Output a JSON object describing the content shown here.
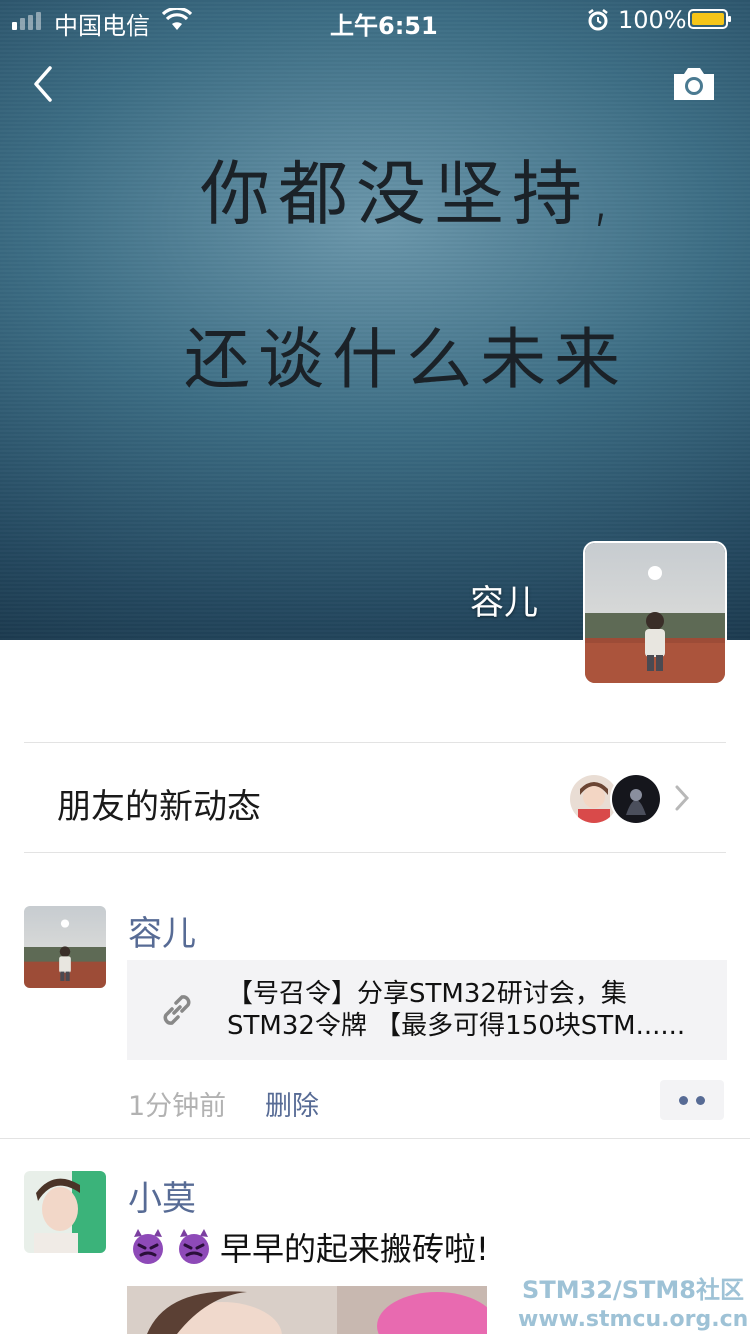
{
  "status_bar": {
    "carrier": "中国电信",
    "time": "上午6:51",
    "battery": "100%"
  },
  "cover": {
    "line1": "你都没坚持,",
    "line2": "还谈什么未来",
    "owner_name": "容儿"
  },
  "friends_updates": {
    "label": "朋友的新动态"
  },
  "posts": [
    {
      "name": "容儿",
      "link_line1": "【号召令】分享STM32研讨会，集",
      "link_line2": "STM32令牌 【最多可得150块STM......",
      "time": "1分钟前",
      "delete_label": "删除"
    },
    {
      "name": "小莫",
      "text": "早早的起来搬砖啦!"
    }
  ],
  "watermark": {
    "line1": "STM32/STM8社区",
    "line2": "www.stmcu.org.cn"
  },
  "colors": {
    "link_name": "#576b95",
    "timestamp": "#b2b2b2",
    "card_bg": "#f3f3f5"
  },
  "icons": [
    "back-icon",
    "camera-icon",
    "wifi-icon",
    "alarm-icon",
    "battery-icon",
    "chevron-right-icon",
    "link-icon",
    "devil-emoji-icon"
  ]
}
